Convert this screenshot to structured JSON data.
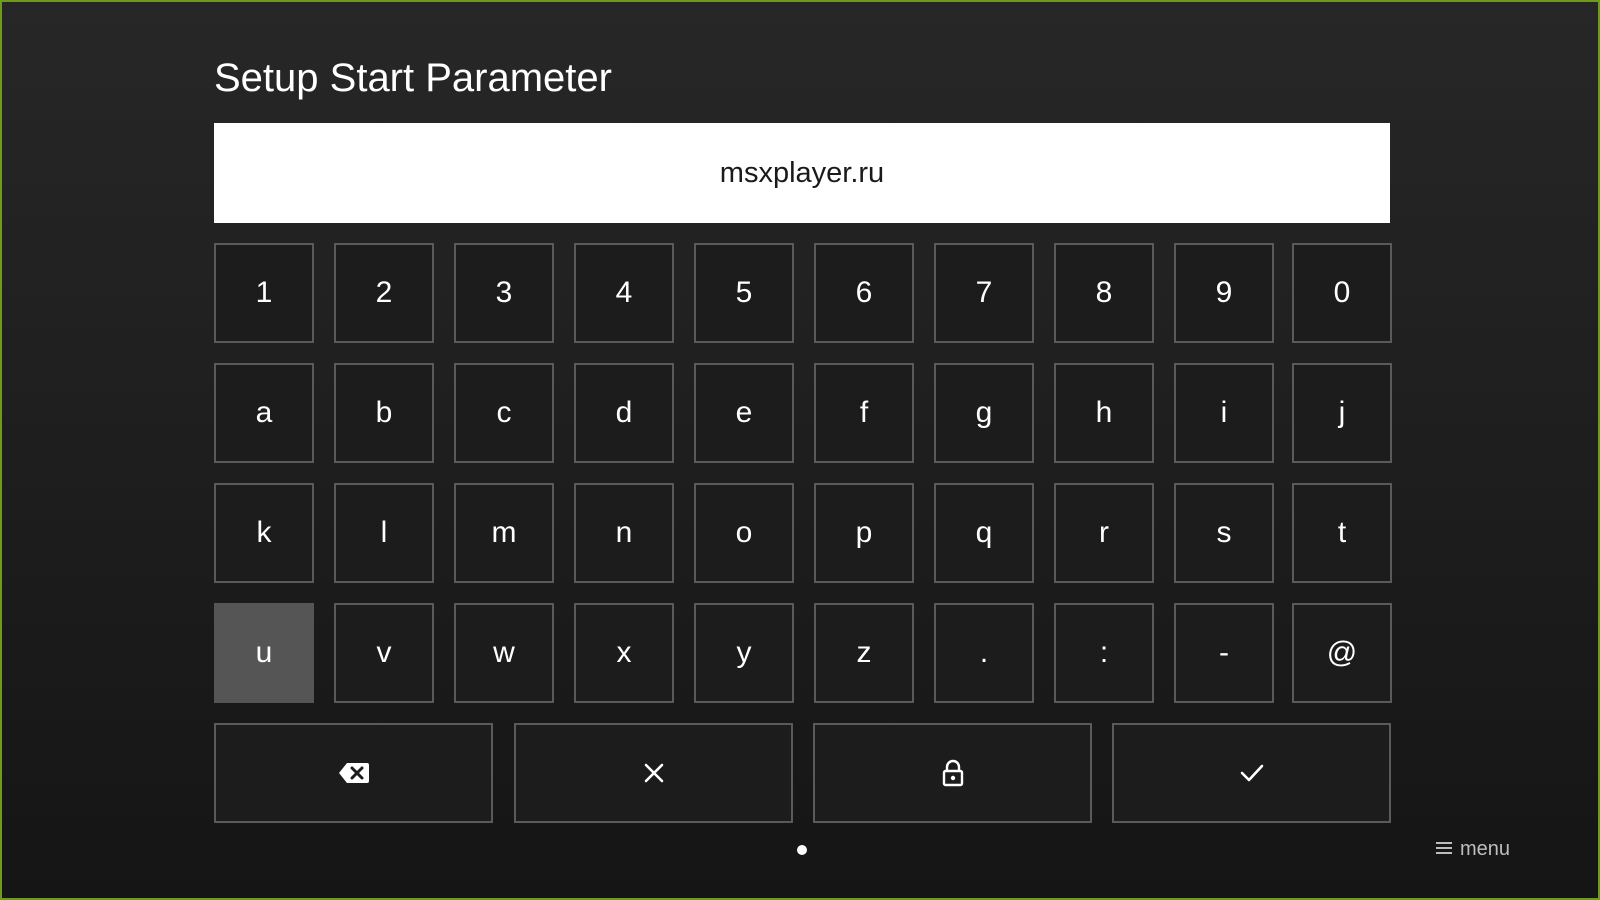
{
  "title": "Setup Start Parameter",
  "input": {
    "value": "msxplayer.ru"
  },
  "keyboard": {
    "rows": [
      [
        "1",
        "2",
        "3",
        "4",
        "5",
        "6",
        "7",
        "8",
        "9",
        "0"
      ],
      [
        "a",
        "b",
        "c",
        "d",
        "e",
        "f",
        "g",
        "h",
        "i",
        "j"
      ],
      [
        "k",
        "l",
        "m",
        "n",
        "o",
        "p",
        "q",
        "r",
        "s",
        "t"
      ],
      [
        "u",
        "v",
        "w",
        "x",
        "y",
        "z",
        ".",
        ":",
        "-",
        "@"
      ]
    ],
    "focused_key": "u",
    "actions": [
      {
        "name": "backspace",
        "icon": "backspace-icon"
      },
      {
        "name": "clear",
        "icon": "close-icon"
      },
      {
        "name": "lock",
        "icon": "lock-icon"
      },
      {
        "name": "confirm",
        "icon": "check-icon"
      }
    ]
  },
  "pager": {
    "pages": 1,
    "current": 1
  },
  "menu": {
    "label": "menu",
    "icon": "hamburger-icon"
  },
  "colors": {
    "frame_border": "#6f9a1a",
    "key_border": "#5a5a5a",
    "key_focused": "#555555",
    "input_background": "#ffffff"
  }
}
